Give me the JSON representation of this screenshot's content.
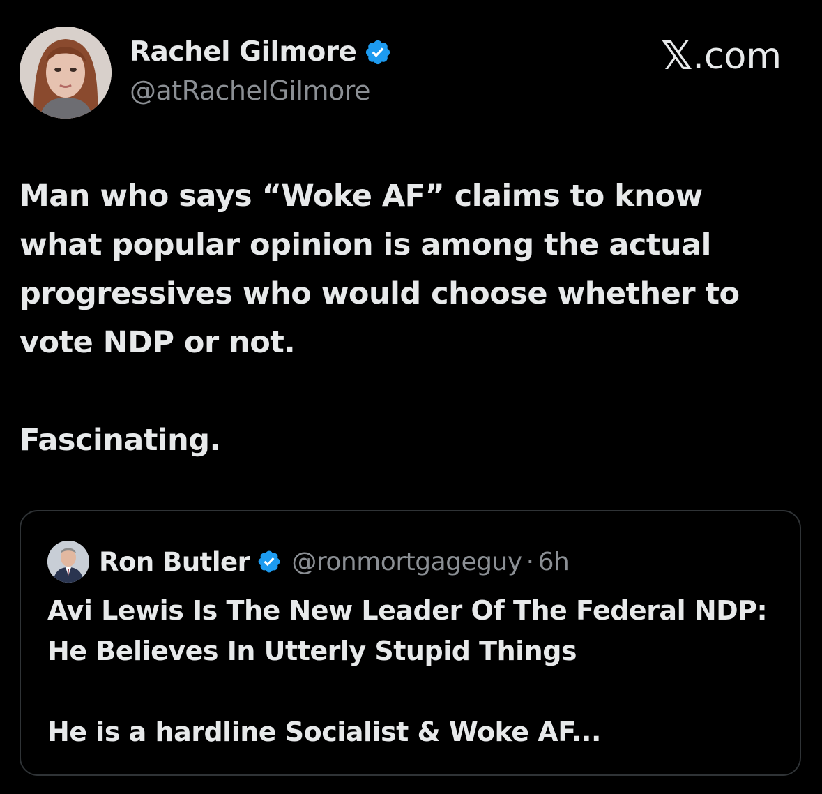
{
  "post": {
    "author": {
      "name": "Rachel Gilmore",
      "handle": "@atRachelGilmore",
      "verified": true,
      "avatar_icon": "profile-photo"
    },
    "brand": {
      "logo": "𝕏",
      "label": ".com"
    },
    "text": {
      "paragraph_1": "Man who says “Woke AF” claims to know what popular opinion is among the actual progressives who would choose whether to vote NDP or not.",
      "paragraph_2": "Fascinating."
    },
    "quoted": {
      "author_name": "Ron Butler",
      "handle": "@ronmortgageguy",
      "separator": "·",
      "time": "6h",
      "verified": true,
      "text_paragraph_1": "Avi Lewis Is The New Leader Of The Federal NDP: He Believes In Utterly Stupid Things",
      "text_paragraph_2": "He is a hardline Socialist & Woke AF..."
    }
  },
  "colors": {
    "background": "#000000",
    "text_primary": "#e7e9ea",
    "text_secondary": "#8b8f94",
    "verified_blue": "#1d9bf0",
    "card_border": "#2f3336"
  }
}
